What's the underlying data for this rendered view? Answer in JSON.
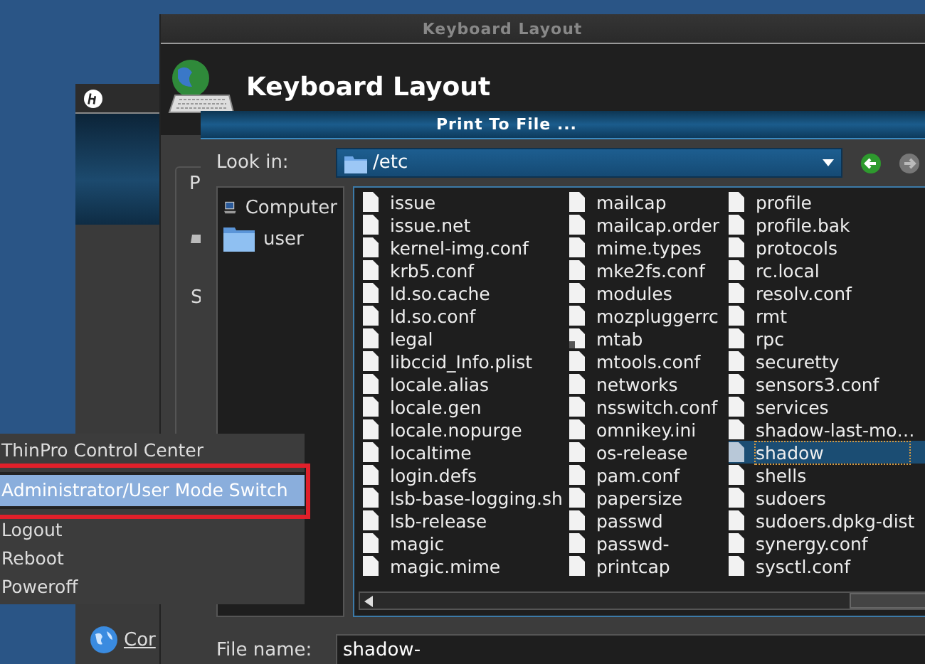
{
  "control_center_window": {
    "link": "Cor"
  },
  "keyboard_window": {
    "title": "Keyboard Layout",
    "heading": "Keyboard Layout",
    "tab_label": "P",
    "field_label": "S"
  },
  "print_dialog": {
    "title": "Print To File ...",
    "look_in_label": "Look in:",
    "look_in_value": "/etc",
    "nav_buttons": [
      {
        "kind": "back",
        "disabled": false
      },
      {
        "kind": "forward",
        "disabled": true
      }
    ],
    "places": [
      {
        "label": "Computer",
        "kind": "computer"
      },
      {
        "label": "user",
        "kind": "folder"
      }
    ],
    "files": [
      {
        "name": "issue",
        "kind": "file",
        "selected": false
      },
      {
        "name": "issue.net",
        "kind": "file",
        "selected": false
      },
      {
        "name": "kernel-img.conf",
        "kind": "file",
        "selected": false
      },
      {
        "name": "krb5.conf",
        "kind": "file",
        "selected": false
      },
      {
        "name": "ld.so.cache",
        "kind": "file",
        "selected": false
      },
      {
        "name": "ld.so.conf",
        "kind": "file",
        "selected": false
      },
      {
        "name": "legal",
        "kind": "file",
        "selected": false
      },
      {
        "name": "libccid_Info.plist",
        "kind": "file",
        "selected": false
      },
      {
        "name": "locale.alias",
        "kind": "file",
        "selected": false
      },
      {
        "name": "locale.gen",
        "kind": "file",
        "selected": false
      },
      {
        "name": "locale.nopurge",
        "kind": "file",
        "selected": false
      },
      {
        "name": "localtime",
        "kind": "file",
        "selected": false
      },
      {
        "name": "login.defs",
        "kind": "file",
        "selected": false
      },
      {
        "name": "lsb-base-logging.sh",
        "kind": "file",
        "selected": false
      },
      {
        "name": "lsb-release",
        "kind": "file",
        "selected": false
      },
      {
        "name": "magic",
        "kind": "file",
        "selected": false
      },
      {
        "name": "magic.mime",
        "kind": "file",
        "selected": false
      },
      {
        "name": "mailcap",
        "kind": "file",
        "selected": false
      },
      {
        "name": "mailcap.order",
        "kind": "file",
        "selected": false
      },
      {
        "name": "mime.types",
        "kind": "file",
        "selected": false
      },
      {
        "name": "mke2fs.conf",
        "kind": "file",
        "selected": false
      },
      {
        "name": "modules",
        "kind": "file",
        "selected": false
      },
      {
        "name": "mozpluggerrc",
        "kind": "file",
        "selected": false
      },
      {
        "name": "mtab",
        "kind": "link",
        "selected": false
      },
      {
        "name": "mtools.conf",
        "kind": "file",
        "selected": false
      },
      {
        "name": "networks",
        "kind": "file",
        "selected": false
      },
      {
        "name": "nsswitch.conf",
        "kind": "file",
        "selected": false
      },
      {
        "name": "omnikey.ini",
        "kind": "file",
        "selected": false
      },
      {
        "name": "os-release",
        "kind": "file",
        "selected": false
      },
      {
        "name": "pam.conf",
        "kind": "file",
        "selected": false
      },
      {
        "name": "papersize",
        "kind": "file",
        "selected": false
      },
      {
        "name": "passwd",
        "kind": "file",
        "selected": false
      },
      {
        "name": "passwd-",
        "kind": "file",
        "selected": false
      },
      {
        "name": "printcap",
        "kind": "file",
        "selected": false
      },
      {
        "name": "profile",
        "kind": "file",
        "selected": false
      },
      {
        "name": "profile.bak",
        "kind": "file",
        "selected": false
      },
      {
        "name": "protocols",
        "kind": "file",
        "selected": false
      },
      {
        "name": "rc.local",
        "kind": "file",
        "selected": false
      },
      {
        "name": "resolv.conf",
        "kind": "file",
        "selected": false
      },
      {
        "name": "rmt",
        "kind": "file",
        "selected": false
      },
      {
        "name": "rpc",
        "kind": "file",
        "selected": false
      },
      {
        "name": "securetty",
        "kind": "file",
        "selected": false
      },
      {
        "name": "sensors3.conf",
        "kind": "file",
        "selected": false
      },
      {
        "name": "services",
        "kind": "file",
        "selected": false
      },
      {
        "name": "shadow-last-mo…",
        "kind": "file",
        "selected": false
      },
      {
        "name": "shadow",
        "kind": "file",
        "selected": true
      },
      {
        "name": "shells",
        "kind": "file",
        "selected": false
      },
      {
        "name": "sudoers",
        "kind": "file",
        "selected": false
      },
      {
        "name": "sudoers.dpkg-dist",
        "kind": "file",
        "selected": false
      },
      {
        "name": "synergy.conf",
        "kind": "file",
        "selected": false
      },
      {
        "name": "sysctl.conf",
        "kind": "file",
        "selected": false
      }
    ],
    "file_name_label": "File name:",
    "file_name_value": "shadow-"
  },
  "menu": {
    "items": [
      {
        "label": "ThinPro Control Center",
        "selected": false
      },
      {
        "label": "Administrator/User Mode Switch",
        "selected": true
      },
      {
        "label": "Logout",
        "selected": false
      },
      {
        "label": "Reboot",
        "selected": false
      },
      {
        "label": "Poweroff",
        "selected": false
      }
    ]
  }
}
